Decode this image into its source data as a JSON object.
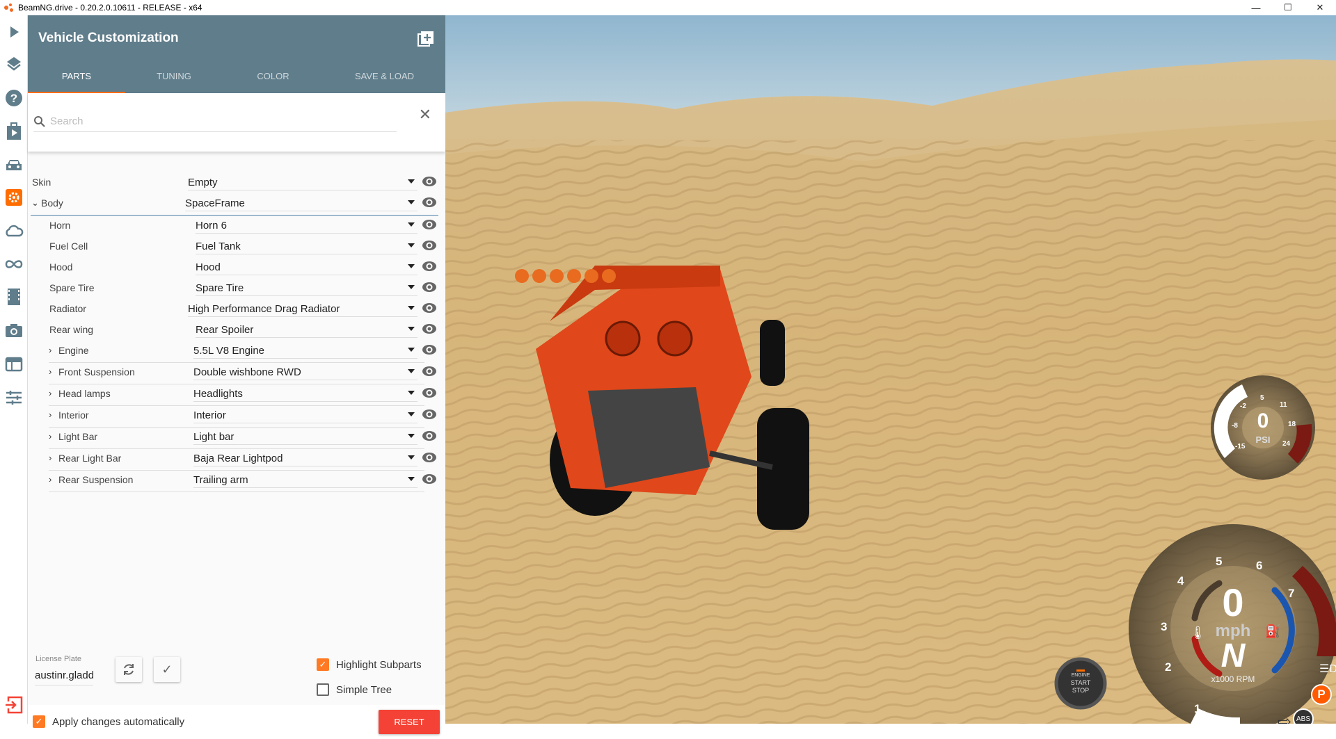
{
  "window": {
    "title": "BeamNG.drive - 0.20.2.0.10611 - RELEASE - x64",
    "minimize": "—",
    "maximize": "☐",
    "close": "✕"
  },
  "panel": {
    "title": "Vehicle Customization",
    "tabs": [
      {
        "label": "PARTS",
        "active": true
      },
      {
        "label": "TUNING"
      },
      {
        "label": "COLOR"
      },
      {
        "label": "SAVE & LOAD"
      }
    ],
    "search": {
      "placeholder": "Search",
      "value": ""
    },
    "parts": [
      {
        "label": "Skin",
        "value": "Empty"
      },
      {
        "label": "Body",
        "value": "SpaceFrame",
        "expanded": true
      },
      {
        "label": "Horn",
        "value": "Horn 6"
      },
      {
        "label": "Fuel Cell",
        "value": "Fuel Tank"
      },
      {
        "label": "Hood",
        "value": "Hood"
      },
      {
        "label": "Spare Tire",
        "value": "Spare Tire"
      },
      {
        "label": "Radiator",
        "value": "High Performance Drag Radiator"
      },
      {
        "label": "Rear wing",
        "value": "Rear Spoiler"
      },
      {
        "label": "Engine",
        "value": "5.5L V8 Engine"
      },
      {
        "label": "Front Suspension",
        "value": "Double wishbone RWD"
      },
      {
        "label": "Head lamps",
        "value": "Headlights"
      },
      {
        "label": "Interior",
        "value": "Interior"
      },
      {
        "label": "Light Bar",
        "value": "Light bar"
      },
      {
        "label": "Rear Light Bar",
        "value": "Baja Rear Lightpod"
      },
      {
        "label": "Rear Suspension",
        "value": "Trailing arm"
      }
    ],
    "license_plate": {
      "label": "License Plate",
      "value": "austinr.gladde"
    },
    "highlight_subparts": {
      "label": "Highlight Subparts",
      "checked": true
    },
    "simple_tree": {
      "label": "Simple Tree",
      "checked": false
    },
    "apply_auto": {
      "label": "Apply changes automatically",
      "checked": true
    },
    "reset_label": "RESET",
    "check_mark": "✓"
  },
  "hud": {
    "boost": {
      "value": "0",
      "unit": "PSI",
      "ticks": [
        "-15",
        "-8",
        "-2",
        "5",
        "11",
        "18",
        "24"
      ]
    },
    "speed": {
      "value": "0",
      "unit": "mph",
      "gear": "N",
      "rpm_label": "x1000 RPM",
      "ticks": [
        "1",
        "2",
        "3",
        "4",
        "5",
        "6",
        "7"
      ]
    },
    "engine_button": {
      "line1": "ENGINE",
      "line2": "START",
      "line3": "STOP"
    },
    "abs": "ABS",
    "parking": "P"
  },
  "colors": {
    "header": "#607d8b",
    "accent": "#ff7a22",
    "reset": "#f44336"
  }
}
